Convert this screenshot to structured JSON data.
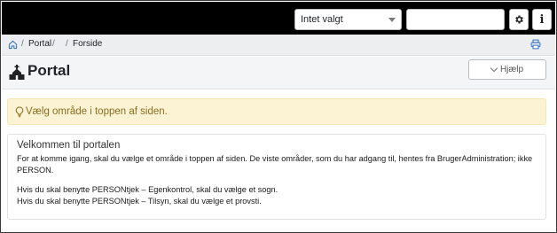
{
  "topbar": {
    "area_select_value": "Intet valgt",
    "search_value": ""
  },
  "breadcrumb": {
    "items": [
      "Portal",
      "Forside"
    ]
  },
  "page": {
    "title": "Portal",
    "help_label": "Hjælp"
  },
  "alert": {
    "text": "Vælg område i toppen af siden."
  },
  "welcome": {
    "title": "Velkommen til portalen",
    "line1": "For at komme igang, skal du vælge et område i toppen af siden. De viste områder, som du har adgang til, hentes fra BrugerAdministration; ikke",
    "line2": "PERSON.",
    "line3": "Hvis du skal benytte PERSONtjek – Egenkontrol, skal du vælge et sogn.",
    "line4": "Hvis du skal benytte PERSONtjek – Tilsyn, skal du vælge et provsti."
  },
  "colors": {
    "topbar": "#000000",
    "alert_bg": "#fcf2d4",
    "alert_text": "#8a6d1e",
    "link_blue": "#2f6fc2"
  },
  "icons": [
    "gear-icon",
    "info-icon",
    "home-icon",
    "print-icon",
    "church-logo-icon",
    "chevron-down-icon",
    "lightbulb-icon"
  ]
}
